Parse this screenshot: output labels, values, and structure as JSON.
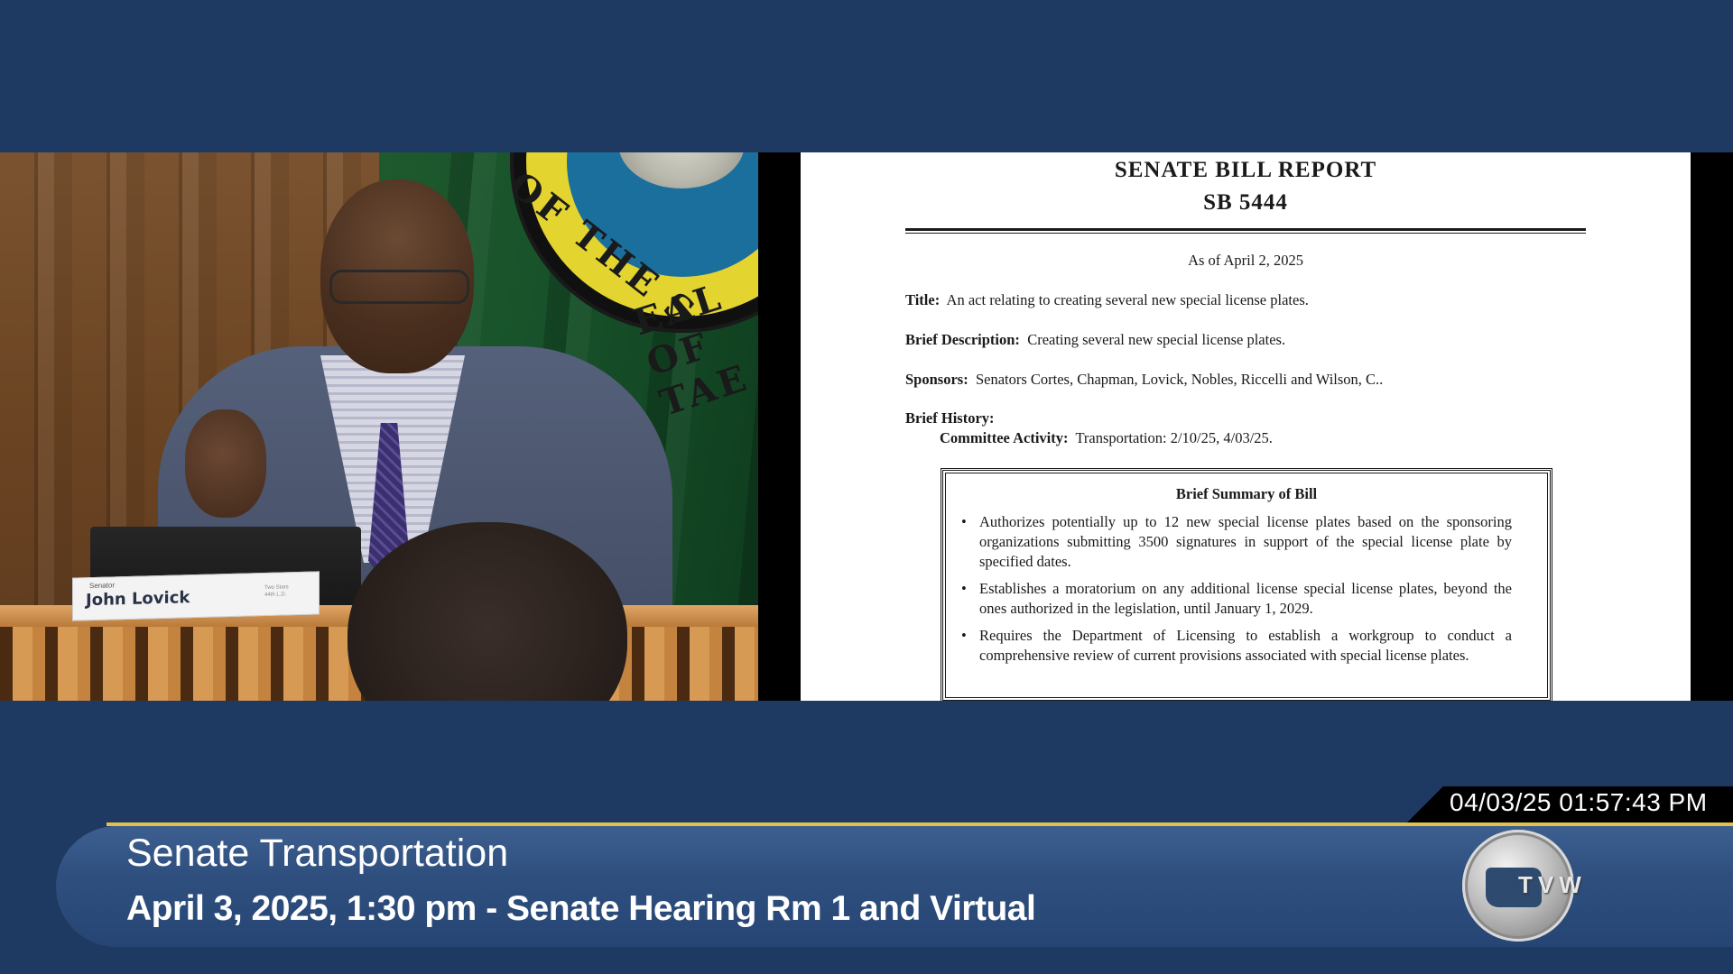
{
  "camera": {
    "nameplate_small": "Senator",
    "nameplate_name": "John Lovick",
    "nameplate_right_1": "Two Stars",
    "nameplate_right_2": "44th L.D.",
    "seal_text_1": "OF THE S",
    "seal_text_2": "EAL OF TAE"
  },
  "document": {
    "title": "SENATE BILL REPORT",
    "bill_number": "SB 5444",
    "as_of": "As of April 2, 2025",
    "title_label": "Title:",
    "title_value": "An act relating to creating several new special license plates.",
    "brief_desc_label": "Brief Description:",
    "brief_desc_value": "Creating several new special license plates.",
    "sponsors_label": "Sponsors:",
    "sponsors_value": "Senators Cortes, Chapman, Lovick, Nobles, Riccelli and Wilson, C..",
    "brief_history_label": "Brief History:",
    "committee_label": "Committee Activity:",
    "committee_value": "Transportation: 2/10/25, 4/03/25.",
    "summary_title": "Brief Summary of Bill",
    "bullets": [
      "Authorizes potentially up to 12 new special license plates based on the sponsoring organizations submitting 3500 signatures in support of the special license plate by specified dates.",
      "Establishes a moratorium on any additional license special license plates, beyond the ones authorized in the legislation, until January 1, 2029.",
      "Requires the Department of Licensing to establish a workgroup to conduct a comprehensive review of current provisions associated with special license plates."
    ]
  },
  "lower_third": {
    "timestamp": "04/03/25 01:57:43 PM",
    "title": "Senate Transportation",
    "subtitle": "April 3, 2025, 1:30 pm - Senate Hearing Rm 1 and Virtual",
    "logo_text": "TVW"
  },
  "colors": {
    "background": "#1f3a62",
    "accent_gold": "#e3c14a",
    "banner": "#2f507f"
  }
}
